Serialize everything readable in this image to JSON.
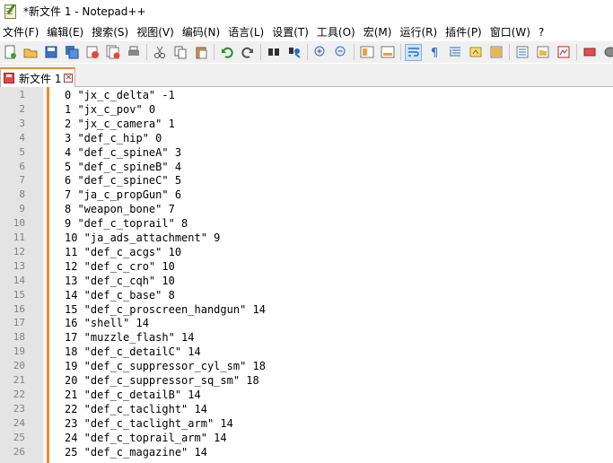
{
  "window": {
    "title": "*新文件 1 - Notepad++"
  },
  "menu": [
    "文件(F)",
    "编辑(E)",
    "搜索(S)",
    "视图(V)",
    "编码(N)",
    "语言(L)",
    "设置(T)",
    "工具(O)",
    "宏(M)",
    "运行(R)",
    "插件(P)",
    "窗口(W)",
    "?"
  ],
  "toolbar": {
    "icons": [
      "new-file-icon",
      "open-file-icon",
      "save-icon",
      "save-all-icon",
      "close-icon",
      "close-all-icon",
      "print-icon",
      "cut-icon",
      "copy-icon",
      "paste-icon",
      "undo-icon",
      "redo-icon",
      "find-icon",
      "replace-icon",
      "zoom-in-icon",
      "zoom-out-icon",
      "sync-vertical-icon",
      "sync-horizontal-icon",
      "word-wrap-icon",
      "show-all-chars-icon",
      "indent-guide-icon",
      "user-lang-icon",
      "doc-map-icon",
      "function-list-icon",
      "folder-workspace-icon",
      "monitor-icon",
      "record-macro-icon",
      "stop-macro-icon"
    ]
  },
  "tab": {
    "label": "新文件 1"
  },
  "editor": {
    "lines": [
      {
        "n": "1",
        "text": "0 \"jx_c_delta\" -1"
      },
      {
        "n": "2",
        "text": "1 \"jx_c_pov\" 0"
      },
      {
        "n": "3",
        "text": "2 \"jx_c_camera\" 1"
      },
      {
        "n": "4",
        "text": "3 \"def_c_hip\" 0"
      },
      {
        "n": "5",
        "text": "4 \"def_c_spineA\" 3"
      },
      {
        "n": "6",
        "text": "5 \"def_c_spineB\" 4"
      },
      {
        "n": "7",
        "text": "6 \"def_c_spineC\" 5"
      },
      {
        "n": "8",
        "text": "7 \"ja_c_propGun\" 6"
      },
      {
        "n": "9",
        "text": "8 \"weapon_bone\" 7"
      },
      {
        "n": "10",
        "text": "9 \"def_c_toprail\" 8"
      },
      {
        "n": "11",
        "text": "10 \"ja_ads_attachment\" 9"
      },
      {
        "n": "12",
        "text": "11 \"def_c_acgs\" 10"
      },
      {
        "n": "13",
        "text": "12 \"def_c_cro\" 10"
      },
      {
        "n": "14",
        "text": "13 \"def_c_cqh\" 10"
      },
      {
        "n": "15",
        "text": "14 \"def_c_base\" 8"
      },
      {
        "n": "16",
        "text": "15 \"def_c_proscreen_handgun\" 14"
      },
      {
        "n": "17",
        "text": "16 \"shell\" 14"
      },
      {
        "n": "18",
        "text": "17 \"muzzle_flash\" 14"
      },
      {
        "n": "19",
        "text": "18 \"def_c_detailC\" 14"
      },
      {
        "n": "20",
        "text": "19 \"def_c_suppressor_cyl_sm\" 18"
      },
      {
        "n": "21",
        "text": "20 \"def_c_suppressor_sq_sm\" 18"
      },
      {
        "n": "22",
        "text": "21 \"def_c_detailB\" 14"
      },
      {
        "n": "23",
        "text": "22 \"def_c_taclight\" 14"
      },
      {
        "n": "24",
        "text": "23 \"def_c_taclight_arm\" 14"
      },
      {
        "n": "25",
        "text": "24 \"def_c_toprail_arm\" 14"
      },
      {
        "n": "26",
        "text": "25 \"def_c_magazine\" 14"
      }
    ]
  },
  "colors": {
    "accent_orange": "#f28c28",
    "gutter": "#e4e4e4",
    "line_number": "#808080"
  }
}
